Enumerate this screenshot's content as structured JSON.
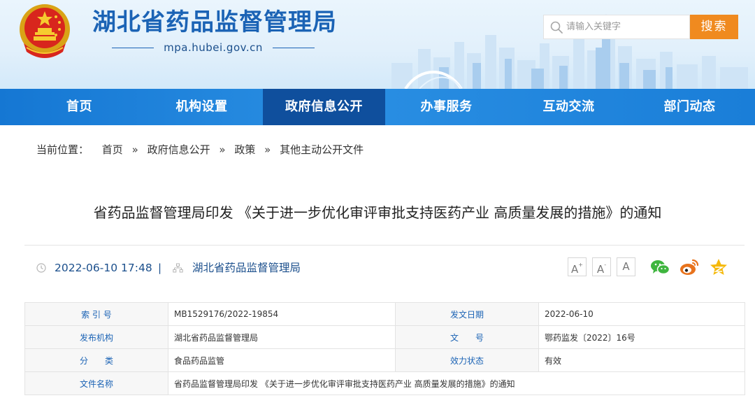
{
  "header": {
    "site_title": "湖北省药品监督管理局",
    "domain": "mpa.hubei.gov.cn",
    "search_placeholder": "请输入关键字",
    "search_button": "搜索"
  },
  "nav": {
    "items": [
      "首页",
      "机构设置",
      "政府信息公开",
      "办事服务",
      "互动交流",
      "部门动态"
    ],
    "active": "政府信息公开"
  },
  "breadcrumb": {
    "prefix": "当前位置：",
    "separator": "»",
    "items": [
      "首页",
      "政府信息公开",
      "政策",
      "其他主动公开文件"
    ]
  },
  "article": {
    "title": "省药品监督管理局印发 《关于进一步优化审评审批支持医药产业 高质量发展的措施》的通知",
    "datetime": "2022-06-10 17:48",
    "divider": "|",
    "source": "湖北省药品监督管理局"
  },
  "font_controls": [
    "A",
    "A",
    "A"
  ],
  "share_icons": [
    "wechat-icon",
    "weibo-icon",
    "qzone-icon"
  ],
  "colors": {
    "brand_blue": "#1b63b5",
    "nav_blue": "#1a7ed8",
    "nav_active": "#0f4f9d",
    "search_orange": "#f08a1f",
    "wechat_green": "#3fb53f",
    "weibo_orange": "#e8731d",
    "qzone_yellow": "#f5b90b"
  },
  "info_table": {
    "rows": [
      [
        "索 引 号",
        "MB1529176/2022-19854",
        "发文日期",
        "2022-06-10"
      ],
      [
        "发布机构",
        "湖北省药品监督管理局",
        "文　　号",
        "鄂药监发〔2022〕16号"
      ],
      [
        "分　　类",
        "食品药品监管",
        "效力状态",
        "有效"
      ]
    ],
    "last_row": [
      "文件名称",
      "省药品监督管理局印发 《关于进一步优化审评审批支持医药产业 高质量发展的措施》的通知"
    ]
  }
}
